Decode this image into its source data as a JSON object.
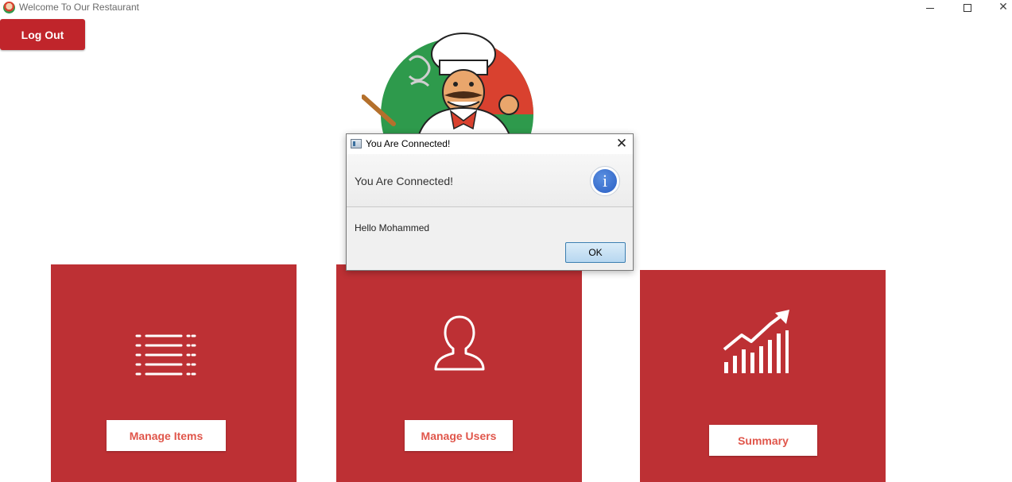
{
  "window": {
    "title": "Welcome To Our Restaurant"
  },
  "logout_label": "Log Out",
  "tiles": [
    {
      "label": "Manage Items",
      "icon": "list-icon"
    },
    {
      "label": "Manage Users",
      "icon": "user-icon"
    },
    {
      "label": "Summary",
      "icon": "growth-chart-icon"
    }
  ],
  "dialog": {
    "title": "You Are Connected!",
    "header": "You Are Connected!",
    "content": "Hello Mohammed",
    "ok_label": "OK",
    "icon": "info-icon"
  },
  "colors": {
    "tile": "#bd3034",
    "logout": "#c0252b",
    "tile_text": "#e0564b"
  }
}
